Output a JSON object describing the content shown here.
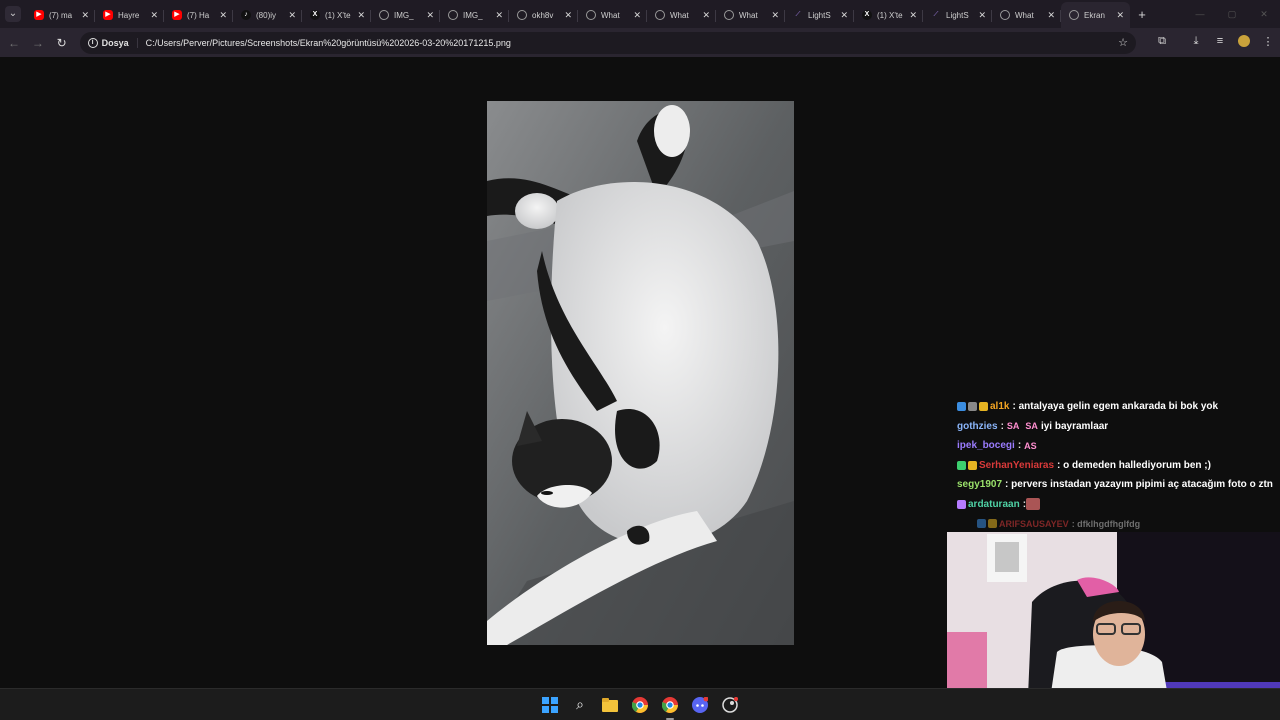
{
  "browser": {
    "tabs": [
      {
        "icon": "youtube-icon",
        "title": "(7) ma"
      },
      {
        "icon": "youtube-icon",
        "title": "Hayre"
      },
      {
        "icon": "youtube-icon",
        "title": "(7) Ha"
      },
      {
        "icon": "tiktok-icon",
        "title": "(80)iy"
      },
      {
        "icon": "x-icon",
        "title": "(1) X'te"
      },
      {
        "icon": "globe-icon",
        "title": "IMG_"
      },
      {
        "icon": "globe-icon",
        "title": "IMG_"
      },
      {
        "icon": "globe-icon",
        "title": "okh8v"
      },
      {
        "icon": "globe-icon",
        "title": "What"
      },
      {
        "icon": "globe-icon",
        "title": "What"
      },
      {
        "icon": "globe-icon",
        "title": "What"
      },
      {
        "icon": "feather-icon",
        "title": "LightS"
      },
      {
        "icon": "x-icon",
        "title": "(1) X'te"
      },
      {
        "icon": "feather-icon",
        "title": "LightS"
      },
      {
        "icon": "globe-icon",
        "title": "What"
      },
      {
        "icon": "globe-icon",
        "title": "Ekran",
        "active": true
      }
    ],
    "address": {
      "chip_label": "Dosya",
      "url": "C:/Users/Perver/Pictures/Screenshots/Ekran%20görüntüsü%202026-03-20%20171215.png"
    }
  },
  "chat": {
    "messages": [
      {
        "user": "al1k",
        "user_color": "#f5a623",
        "badges": [
          "#3b8de0",
          "#888888",
          "#e6b422"
        ],
        "text": ": antalyaya gelin egem ankarada bi bok yok"
      },
      {
        "user": "gothzies",
        "user_color": "#8ab4f8",
        "badges": [],
        "pre": ": ",
        "emotes": [
          "SA",
          "SA"
        ],
        "text": " iyi bayramlaar"
      },
      {
        "user": "ipek_bocegi",
        "user_color": "#9b7cff",
        "badges": [],
        "pre": ": ",
        "emotes": [
          "AS"
        ],
        "text": ""
      },
      {
        "user": "SerhanYeniaras",
        "user_color": "#d93a3a",
        "badges": [
          "#3ccf6e",
          "#e6b422"
        ],
        "text": ": o demeden hallediyorum ben ;)"
      },
      {
        "user": "segy1907",
        "user_color": "#9be26b",
        "badges": [],
        "text": ": pervers instadan yazayım pipimi aç atacağım foto o ztn"
      },
      {
        "user": "ardaturaan",
        "user_color": "#4fd1a5",
        "badges": [
          "#b57cff"
        ],
        "pre": ": ",
        "emotes": [],
        "text": ""
      },
      {
        "user": "ARIFSAUSAYEV",
        "user_color": "#d93a3a",
        "badges": [
          "#3b8de0",
          "#e6b422"
        ],
        "text": ": dfklhgdfhglfdg",
        "faded": true
      }
    ]
  }
}
